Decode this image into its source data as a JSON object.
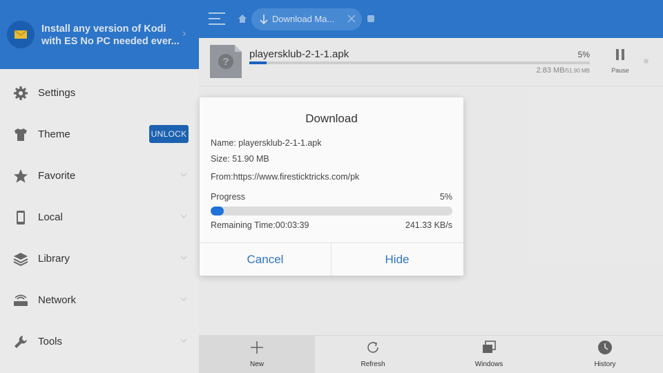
{
  "colors": {
    "brand": "#2e7ad1",
    "accent": "#1e66c8",
    "unlock_bg": "#1e66b8"
  },
  "promo": {
    "icon": "email-icon",
    "text": "Install any version of Kodi with ES No PC needed ever...",
    "arrow": "›"
  },
  "sidebar": {
    "items": [
      {
        "label": "Settings",
        "icon": "gear-icon"
      },
      {
        "label": "Theme",
        "icon": "shirt-icon",
        "badge": "UNLOCK"
      },
      {
        "label": "Favorite",
        "icon": "star-icon"
      },
      {
        "label": "Local",
        "icon": "phone-icon"
      },
      {
        "label": "Library",
        "icon": "layers-icon"
      },
      {
        "label": "Network",
        "icon": "router-icon"
      },
      {
        "label": "Tools",
        "icon": "wrench-icon"
      }
    ]
  },
  "topbar": {
    "tab_label": "Download Ma...",
    "icons": [
      "menu-icon",
      "home-icon",
      "download-icon",
      "close-icon"
    ]
  },
  "download": {
    "file_name": "playersklub-2-1-1.apk",
    "percent_text": "5%",
    "progress": 0.05,
    "size_done": "2.83 MB",
    "size_total": "/51.90 MB",
    "pause_label": "Pause"
  },
  "bottombar": {
    "items": [
      {
        "label": "New",
        "icon": "plus-icon"
      },
      {
        "label": "Refresh",
        "icon": "refresh-icon"
      },
      {
        "label": "Windows",
        "icon": "windows-icon"
      },
      {
        "label": "History",
        "icon": "clock-icon"
      }
    ]
  },
  "dialog": {
    "title": "Download",
    "name_line": "Name: playersklub-2-1-1.apk",
    "size_line": "Size: 51.90 MB",
    "from_line": "From:https://www.firesticktricks.com/pk",
    "progress_label": "Progress",
    "progress_text": "5%",
    "progress": 0.05,
    "remaining": "Remaining Time:00:03:39",
    "speed": "241.33 KB/s",
    "cancel_label": "Cancel",
    "hide_label": "Hide"
  }
}
